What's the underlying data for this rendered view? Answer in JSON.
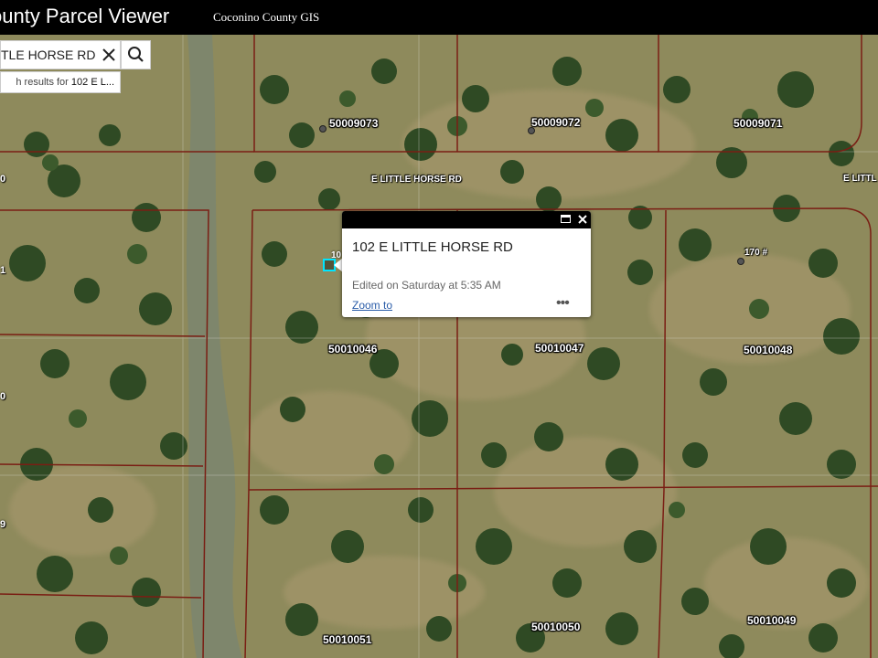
{
  "header": {
    "app_title": "ounty Parcel Viewer",
    "subtitle": "Coconino County GIS"
  },
  "search": {
    "value": "TLE HORSE RD",
    "results_prefix": "h results for ",
    "results_query": "102 E L..."
  },
  "popup": {
    "title": "102 E LITTLE HORSE RD",
    "edited": "Edited on Saturday at 5:35 AM",
    "zoom_label": "Zoom to",
    "more_label": "•••"
  },
  "map": {
    "parcels": [
      "50009073",
      "50009072",
      "50009071",
      "50010046",
      "50010047",
      "50010048",
      "50010051",
      "50010050",
      "50010049"
    ],
    "roads": [
      "E LITTLE HORSE RD",
      "E LITTL"
    ],
    "address_points": [
      "170 #",
      "10"
    ],
    "edge_labels": [
      "0",
      "1",
      "0",
      "9"
    ],
    "colors": {
      "parcel_line": "#7a1e14",
      "selection": "#00e5ff",
      "header_bg": "#000000",
      "link": "#2a5ca8"
    }
  }
}
